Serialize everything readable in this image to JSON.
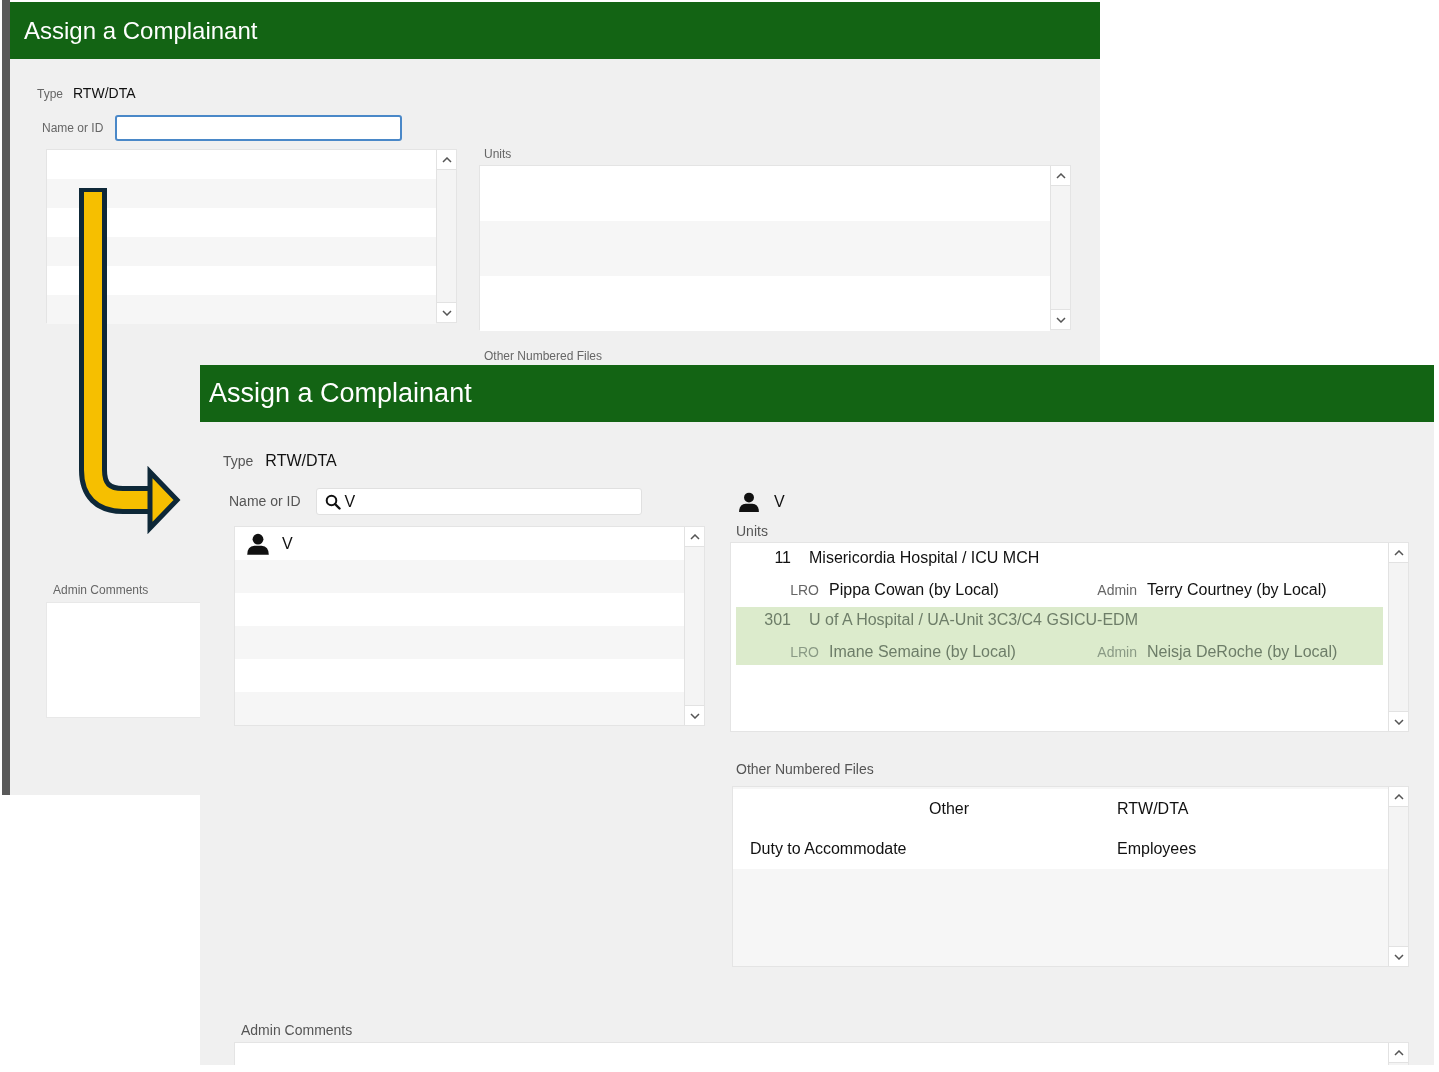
{
  "back_window": {
    "title": "Assign a Complainant",
    "type": {
      "label": "Type",
      "value": "RTW/DTA"
    },
    "name_field": {
      "label": "Name or ID",
      "focused": true
    },
    "units_label": "Units",
    "other_files_label": "Other Numbered Files",
    "admin_comments_label": "Admin Comments"
  },
  "front_window": {
    "title": "Assign a Complainant",
    "type": {
      "label": "Type",
      "value": "RTW/DTA"
    },
    "name_field": {
      "label": "Name or ID",
      "value": "V",
      "focused": false
    },
    "results": [
      {
        "name": "V"
      }
    ],
    "selected_person": "V",
    "units_label": "Units",
    "units": [
      {
        "number": "11",
        "name": "Misericordia Hospital / ICU MCH",
        "lro_label": "LRO",
        "lro": "Pippa Cowan (by Local)",
        "admin_label": "Admin",
        "admin": "Terry Courtney (by Local)",
        "selected": false
      },
      {
        "number": "301",
        "name": "U of A Hospital / UA-Unit 3C3/C4 GSICU-EDM",
        "lro_label": "LRO",
        "lro": "Imane Semaine (by Local)",
        "admin_label": "Admin",
        "admin": "Neisja DeRoche (by Local)",
        "selected": true
      }
    ],
    "other_files_label": "Other Numbered Files",
    "other_files": [
      {
        "column_2": "Other",
        "column_3": "RTW/DTA"
      },
      {
        "column_1": "Duty to Accommodate",
        "column_3": "Employees"
      }
    ],
    "admin_comments_label": "Admin Comments"
  }
}
